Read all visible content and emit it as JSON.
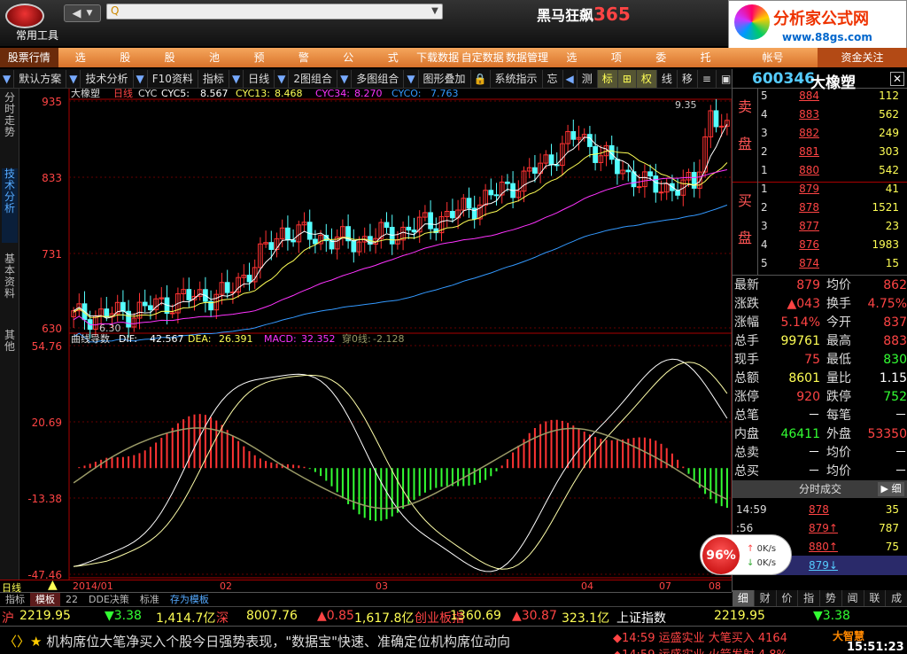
{
  "title": {
    "app_prefix": "黑马狂飙",
    "app_num": "365",
    "menu_tools": "常用工具",
    "back_label": "◀",
    "address": "Q"
  },
  "brand": {
    "name": "分析家公式网",
    "url": "www.88gs.com"
  },
  "menu": [
    "股票行情",
    "选",
    "股",
    "股",
    "池",
    "预",
    "警",
    "公",
    "式",
    "下载数据",
    "自定数据",
    "数据管理",
    "选",
    "项",
    "委",
    "托"
  ],
  "menu_right": [
    "帐号",
    "资金关注"
  ],
  "toolbar": [
    [
      "arr",
      "▼"
    ],
    [
      "",
      "默认方案"
    ],
    [
      "arr",
      "▼"
    ],
    [
      "",
      "技术分析"
    ],
    [
      "arr",
      "▼"
    ],
    [
      "",
      "F10资料"
    ],
    [
      "",
      "指标"
    ],
    [
      "arr",
      "▼"
    ],
    [
      "",
      "日线"
    ],
    [
      "arr",
      "▼"
    ],
    [
      "",
      "2图组合"
    ],
    [
      "arr",
      "▼"
    ],
    [
      "",
      "多图组合"
    ],
    [
      "arr",
      "▼"
    ],
    [
      "",
      "图形叠加"
    ],
    [
      "arr",
      "🔒"
    ],
    [
      "",
      "系统指示"
    ],
    [
      "",
      "忘"
    ],
    [
      "arr",
      "◀"
    ],
    [
      "",
      "测"
    ],
    [
      "on",
      "标"
    ],
    [
      "on",
      "⊞"
    ],
    [
      "on",
      "权"
    ],
    [
      "",
      "线"
    ],
    [
      "",
      "移"
    ],
    [
      "",
      "≡"
    ],
    [
      "",
      "▣"
    ],
    [
      "",
      "▼"
    ]
  ],
  "left_tabs": [
    "分时走势",
    "技术分析",
    "基本资料",
    "其他"
  ],
  "chart": {
    "upper": {
      "name": "大橡塑",
      "period": "日线",
      "ind": "CYC",
      "cyc5": "8.567",
      "cyc13": "8.468",
      "cyc34": "8.270",
      "cyc0": "7.763",
      "labels": [
        "935",
        "833",
        "731",
        "630"
      ],
      "high_label": "9.35",
      "low_label": "6.30"
    },
    "lower": {
      "name": "曲线导数",
      "dif": "42.567",
      "dea": "26.391",
      "macd": "32.352",
      "cross": "-2.128",
      "labels": [
        "54.76",
        "20.69",
        "-13.38",
        "-47.46"
      ]
    },
    "xlabels": [
      "2014/01",
      "02",
      "03",
      "04",
      "07",
      "08"
    ],
    "period_button": "日线"
  },
  "bottom_tabs": [
    [
      "",
      "指标"
    ],
    [
      "on",
      "模板"
    ],
    [
      "",
      "22"
    ],
    [
      "",
      "DDE决策"
    ],
    [
      "",
      "标准"
    ],
    [
      "blue",
      "存为模板"
    ]
  ],
  "quote": {
    "code": "600346",
    "name": "大橡塑",
    "sell_label": [
      "卖",
      "盘"
    ],
    "buy_label": [
      "买",
      "盘"
    ],
    "sells": [
      [
        "5",
        "884",
        "112"
      ],
      [
        "4",
        "883",
        "562"
      ],
      [
        "3",
        "882",
        "249"
      ],
      [
        "2",
        "881",
        "303"
      ],
      [
        "1",
        "880",
        "542"
      ]
    ],
    "buys": [
      [
        "1",
        "879",
        "41"
      ],
      [
        "2",
        "878",
        "1521"
      ],
      [
        "3",
        "877",
        "23"
      ],
      [
        "4",
        "876",
        "1983"
      ],
      [
        "5",
        "874",
        "15"
      ]
    ],
    "rows": [
      [
        "最新",
        "879",
        "均价",
        "862"
      ],
      [
        "涨跌",
        "▲043",
        "换手",
        "4.75%"
      ],
      [
        "涨幅",
        "5.14%",
        "今开",
        "837"
      ],
      [
        "总手",
        "99761",
        "最高",
        "883"
      ],
      [
        "现手",
        "75",
        "最低",
        "830"
      ],
      [
        "总额",
        "8601",
        "量比",
        "1.15"
      ],
      [
        "涨停",
        "920",
        "跌停",
        "752"
      ],
      [
        "总笔",
        "－",
        "每笔",
        "－"
      ],
      [
        "内盘",
        "46411",
        "外盘",
        "53350"
      ],
      [
        "总卖",
        "－",
        "均价",
        "－"
      ],
      [
        "总买",
        "－",
        "均价",
        "－"
      ]
    ],
    "trades_head": "分时成交",
    "trades_btn": "细",
    "trades": [
      [
        "14:59",
        "878",
        "35"
      ],
      [
        ":56",
        "879↑",
        "787"
      ],
      [
        "",
        "880↑",
        "75"
      ],
      [
        "",
        "879↓",
        ""
      ]
    ],
    "tabs": [
      "细",
      "财",
      "价",
      "指",
      "势",
      "闻",
      "联",
      "成"
    ],
    "speed": {
      "pct": "96%",
      "up": "0K/s",
      "down": "0K/s"
    }
  },
  "index_bar": [
    [
      "沪",
      "#f44"
    ],
    [
      "2219.95",
      "#ff5"
    ],
    [
      "▼3.38",
      "#3f3"
    ],
    [
      "1,414.7亿",
      "#ff5"
    ],
    [
      "深",
      "#f44"
    ],
    [
      "8007.76",
      "#ff5"
    ],
    [
      "▲0.85",
      "#f44"
    ],
    [
      "1,617.8亿",
      "#ff5"
    ],
    [
      "创业板指",
      "#f44"
    ],
    [
      "1360.69",
      "#ff5"
    ],
    [
      "▲30.87",
      "#f44"
    ],
    [
      "323.1亿",
      "#ff5"
    ],
    [
      "上证指数",
      "#fff"
    ],
    [
      "2219.95",
      "#ff5"
    ],
    [
      "▼3.38",
      "#3f3"
    ]
  ],
  "news": "机构席位大笔净买入个股今日强势表现，\"数据宝\"快速、准确定位机构席位动向",
  "alerts": [
    "◆14:59 运盛实业 大笔买入 4164",
    "◆14:59 运盛实业 火箭发射 4.8%"
  ],
  "clock": {
    "brand": "大智慧",
    "time": "15:51:23"
  }
}
